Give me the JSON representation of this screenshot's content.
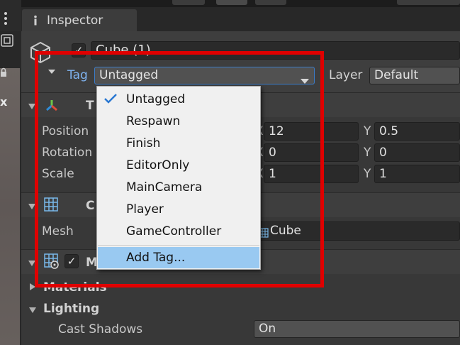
{
  "window": {
    "tab_label": "Inspector"
  },
  "object": {
    "name": "Cube (1)",
    "active": true
  },
  "tag": {
    "label": "Tag",
    "value": "Untagged"
  },
  "layer": {
    "label": "Layer",
    "value": "Default"
  },
  "left_strip": {
    "letter": "x"
  },
  "transform": {
    "title_fragment": "T",
    "position": {
      "label": "Position",
      "x_label": "X",
      "x": "12",
      "y_label": "Y",
      "y": "0.5"
    },
    "rotation": {
      "label": "Rotation",
      "x_label": "X",
      "x": "0",
      "y_label": "Y",
      "y": "0"
    },
    "scale": {
      "label": "Scale",
      "x_label": "X",
      "x": "1",
      "y_label": "Y",
      "y": "1"
    }
  },
  "mesh_filter": {
    "title_fragment": "C",
    "mesh_label": "Mesh",
    "mesh_value": "Cube"
  },
  "mesh_renderer": {
    "title_fragment": "M",
    "materials_label": "Materials",
    "lighting_label": "Lighting",
    "cast_shadows_label": "Cast Shadows",
    "cast_shadows_value": "On"
  },
  "tag_dropdown": {
    "items": [
      "Untagged",
      "Respawn",
      "Finish",
      "EditorOnly",
      "MainCamera",
      "Player",
      "GameController"
    ],
    "selected": "Untagged",
    "add_label": "Add Tag..."
  },
  "colors": {
    "panel_bg": "#383838",
    "popup_bg": "#f0f0f0",
    "popup_highlight": "#99c9f1",
    "annotation_red": "#e00000",
    "tag_label_blue": "#7fb3f0"
  }
}
